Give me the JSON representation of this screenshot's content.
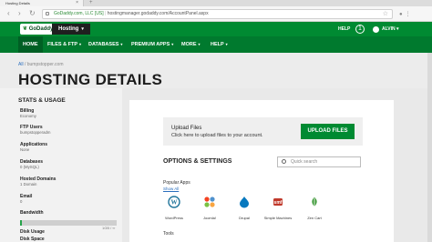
{
  "browser": {
    "tab_title": "Hosting Details",
    "tab_close": "×",
    "new_tab": "+",
    "back": "‹",
    "forward": "›",
    "reload": "↻",
    "url_company": "GoDaddy.com, LLC [US]",
    "url": "hostingmanager.godaddy.com/AccountPanel.aspx",
    "bookmark": "☆"
  },
  "topnav": {
    "logo_mark": "❦",
    "logo": "GoDaddy",
    "product": "Hosting",
    "product_chevron": "▾",
    "help": "HELP",
    "plus_badge": "1",
    "username": "ALVIN",
    "user_chevron": "▾"
  },
  "subnav": [
    {
      "label": "HOME",
      "chevron": ""
    },
    {
      "label": "FILES & FTP",
      "chevron": "▾"
    },
    {
      "label": "DATABASES",
      "chevron": "▾"
    },
    {
      "label": "PREMIUM APPS",
      "chevron": "▾"
    },
    {
      "label": "MORE",
      "chevron": "▾"
    },
    {
      "label": "HELP",
      "chevron": "▾"
    }
  ],
  "header": {
    "breadcrumb_root": "All",
    "breadcrumb_sep": "/",
    "breadcrumb_domain": "bumpstopper.com",
    "title": "HOSTING DETAILS"
  },
  "sidebar": {
    "heading": "STATS & USAGE",
    "items": [
      {
        "label": "Billing",
        "value": "Economy"
      },
      {
        "label": "FTP Users",
        "value": "bumpstopperadm"
      },
      {
        "label": "Applications",
        "value": "None"
      },
      {
        "label": "Databases",
        "value": "0 (MySQL)"
      },
      {
        "label": "Hosted Domains",
        "value": "1 Domain"
      },
      {
        "label": "Email",
        "value": "0"
      },
      {
        "label": "Bandwidth",
        "value": ""
      },
      {
        "label": "Disk Usage",
        "value": ""
      },
      {
        "label": "Disk Space",
        "value": ""
      }
    ],
    "bandwidth_fraction": 0.02,
    "bandwidth_value": "1GB / ∞"
  },
  "content": {
    "upload_title": "Upload Files",
    "upload_sub": "Click here to upload files to your account.",
    "upload_button": "UPLOAD FILES",
    "options_title": "OPTIONS & SETTINGS",
    "search_placeholder": "Quick search",
    "popular_title": "Popular Apps",
    "show_all": "Show All",
    "apps": [
      {
        "name": "WordPress",
        "icon": "wordpress-icon",
        "color": "#21759b"
      },
      {
        "name": "Joomla!",
        "icon": "joomla-icon",
        "color": "#f44321"
      },
      {
        "name": "Drupal",
        "icon": "drupal-icon",
        "color": "#0678be"
      },
      {
        "name": "Simple Machines",
        "icon": "simple-machines-icon",
        "color": "#c0392b"
      },
      {
        "name": "Zen Cart",
        "icon": "zen-cart-icon",
        "color": "#3f9a3a"
      }
    ],
    "tools_title": "Tools"
  }
}
